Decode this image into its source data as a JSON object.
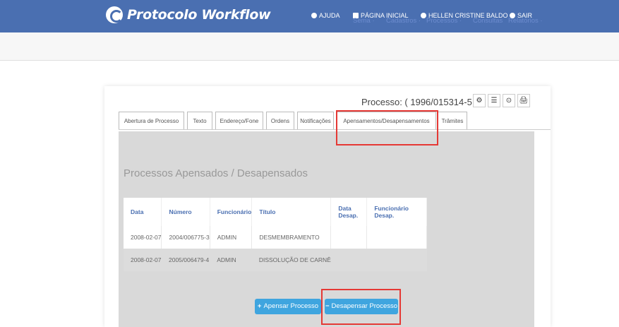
{
  "header": {
    "app_title": "Protocolo Workflow",
    "nav": [
      {
        "label": "AJUDA",
        "icon": "help-icon"
      },
      {
        "label": "PÁGINA INICIAL",
        "icon": "home-icon"
      },
      {
        "label": "HELLEN CRISTINE BALDO",
        "icon": "user-icon"
      },
      {
        "label": "SAIR",
        "icon": "logout-icon"
      }
    ]
  },
  "menu": {
    "items": [
      "Sema ·",
      "Cadastros ·",
      "Processos ·",
      "Consultas",
      "Relatórios ·"
    ]
  },
  "process": {
    "label": "Processo: ( 1996/015314-5 ) -",
    "tools": [
      "⚙",
      "☰",
      "⊙",
      "🖨"
    ]
  },
  "tabs": [
    "Abertura de Processo",
    "Texto",
    "Endereço/Fone",
    "Ordens",
    "Notificações",
    "Apensamentos/Desapensamentos",
    "Trâmites"
  ],
  "section": {
    "title": "Processos Apensados / Desapensados"
  },
  "table": {
    "headers": [
      "Data",
      "Número",
      "Funcionário",
      "Título",
      "Data Desap.",
      "Funcionário Desap."
    ],
    "rows": [
      [
        "2008-02-07",
        "2004/006775-3",
        "ADMIN",
        "DESMEMBRAMENTO",
        "",
        ""
      ],
      [
        "2008-02-07",
        "2005/006479-4",
        "ADMIN",
        "DISSOLUÇÃO DE CARNÊ",
        "",
        ""
      ]
    ]
  },
  "buttons": {
    "apensar": "Apensar Processo",
    "desapensar": "Desapensar Processo"
  },
  "colors": {
    "header_bg": "#4a6fb1",
    "button_bg": "#3fa5df",
    "highlight": "#e53935"
  }
}
